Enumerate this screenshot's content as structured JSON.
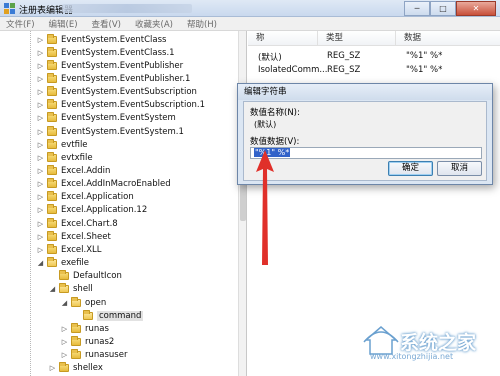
{
  "window": {
    "title": "注册表编辑器",
    "buttons": {
      "minimize": "─",
      "maximize": "□",
      "close": "✕"
    }
  },
  "menu": [
    "文件(F)",
    "编辑(E)",
    "查看(V)",
    "收藏夹(A)",
    "帮助(H)"
  ],
  "tree": {
    "items": [
      {
        "label": "EventSystem.EventClass",
        "depth": 0,
        "expanded": false
      },
      {
        "label": "EventSystem.EventClass.1",
        "depth": 0,
        "expanded": false
      },
      {
        "label": "EventSystem.EventPublisher",
        "depth": 0,
        "expanded": false
      },
      {
        "label": "EventSystem.EventPublisher.1",
        "depth": 0,
        "expanded": false
      },
      {
        "label": "EventSystem.EventSubscription",
        "depth": 0,
        "expanded": false
      },
      {
        "label": "EventSystem.EventSubscription.1",
        "depth": 0,
        "expanded": false
      },
      {
        "label": "EventSystem.EventSystem",
        "depth": 0,
        "expanded": false
      },
      {
        "label": "EventSystem.EventSystem.1",
        "depth": 0,
        "expanded": false
      },
      {
        "label": "evtfile",
        "depth": 0,
        "expanded": false
      },
      {
        "label": "evtxfile",
        "depth": 0,
        "expanded": false
      },
      {
        "label": "Excel.Addin",
        "depth": 0,
        "expanded": false
      },
      {
        "label": "Excel.AddInMacroEnabled",
        "depth": 0,
        "expanded": false
      },
      {
        "label": "Excel.Application",
        "depth": 0,
        "expanded": false
      },
      {
        "label": "Excel.Application.12",
        "depth": 0,
        "expanded": false
      },
      {
        "label": "Excel.Chart.8",
        "depth": 0,
        "expanded": false
      },
      {
        "label": "Excel.Sheet",
        "depth": 0,
        "expanded": false
      },
      {
        "label": "Excel.XLL",
        "depth": 0,
        "expanded": false
      },
      {
        "label": "exefile",
        "depth": 0,
        "expanded": true
      },
      {
        "label": "DefaultIcon",
        "depth": 1,
        "expanded": false,
        "leaf": true
      },
      {
        "label": "shell",
        "depth": 1,
        "expanded": true
      },
      {
        "label": "open",
        "depth": 2,
        "expanded": true
      },
      {
        "label": "command",
        "depth": 3,
        "expanded": false,
        "leaf": true,
        "selected": true
      },
      {
        "label": "runas",
        "depth": 2,
        "expanded": false
      },
      {
        "label": "runas2",
        "depth": 2,
        "expanded": false
      },
      {
        "label": "runasuser",
        "depth": 2,
        "expanded": false
      },
      {
        "label": "shellex",
        "depth": 1,
        "expanded": false
      }
    ]
  },
  "values": {
    "headers": {
      "name": "称",
      "type": "类型",
      "data": "数据"
    },
    "rows": [
      {
        "name": "(默认)",
        "type": "REG_SZ",
        "data": "\"%1\" %*"
      },
      {
        "name": "IsolatedComm...",
        "type": "REG_SZ",
        "data": "\"%1\" %*"
      }
    ]
  },
  "dialog": {
    "title": "编辑字符串",
    "name_label": "数值名称(N):",
    "name_value": "(默认)",
    "data_label": "数值数据(V):",
    "data_value": "\"%1\" %*",
    "ok": "确定",
    "cancel": "取消"
  },
  "watermark": {
    "brand": "系统之家",
    "url": "www.xitongzhijia.net"
  },
  "colors": {
    "arrow": "#e0302a",
    "selection": "#3162c9"
  }
}
